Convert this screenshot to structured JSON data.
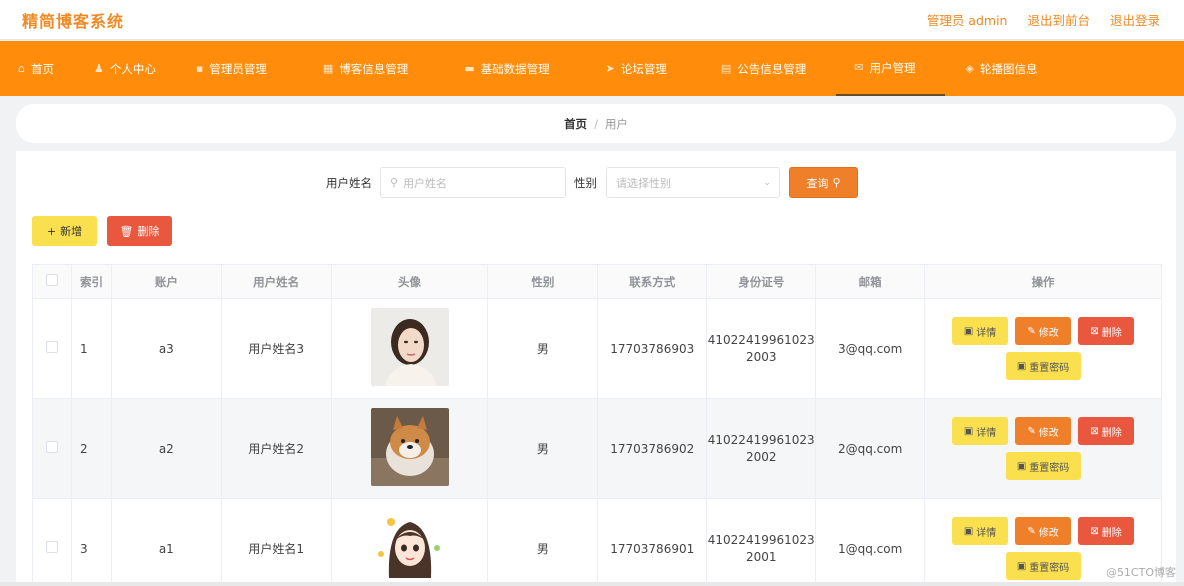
{
  "app": {
    "title": "精简博客系统"
  },
  "topbar": {
    "admin_label": "管理员 admin",
    "front_label": "退出到前台",
    "logout_label": "退出登录"
  },
  "nav": {
    "items": [
      {
        "label": "首页",
        "icon": "home-icon",
        "glyph": "⌂"
      },
      {
        "label": "个人中心",
        "icon": "user-icon",
        "glyph": "♟"
      },
      {
        "label": "管理员管理",
        "icon": "chat-icon",
        "glyph": "▪"
      },
      {
        "label": "博客信息管理",
        "icon": "grid-icon",
        "glyph": "▦"
      },
      {
        "label": "基础数据管理",
        "icon": "briefcase-icon",
        "glyph": "▬"
      },
      {
        "label": "论坛管理",
        "icon": "send-icon",
        "glyph": "➤"
      },
      {
        "label": "公告信息管理",
        "icon": "document-icon",
        "glyph": "▤"
      },
      {
        "label": "用户管理",
        "icon": "mail-icon",
        "glyph": "✉"
      },
      {
        "label": "轮播图信息",
        "icon": "image-icon",
        "glyph": "◈"
      }
    ],
    "active_index": 7
  },
  "breadcrumb": {
    "home": "首页",
    "separator": "/",
    "current": "用户"
  },
  "search": {
    "name_label": "用户姓名",
    "name_placeholder": "用户姓名",
    "gender_label": "性别",
    "gender_placeholder": "请选择性别",
    "query_button": "查询"
  },
  "actions": {
    "add_button": "新增",
    "delete_button": "删除"
  },
  "table": {
    "headers": [
      "索引",
      "账户",
      "用户姓名",
      "头像",
      "性别",
      "联系方式",
      "身份证号",
      "邮箱",
      "操作"
    ],
    "rows": [
      {
        "index": "1",
        "account": "a3",
        "name": "用户姓名3",
        "avatar": "woman-portrait",
        "gender": "男",
        "phone": "17703786903",
        "id_line1": "41022419961023",
        "id_line2": "2003",
        "email": "3@qq.com"
      },
      {
        "index": "2",
        "account": "a2",
        "name": "用户姓名2",
        "avatar": "shiba-dog",
        "gender": "男",
        "phone": "17703786902",
        "id_line1": "41022419961023",
        "id_line2": "2002",
        "email": "2@qq.com"
      },
      {
        "index": "3",
        "account": "a1",
        "name": "用户姓名1",
        "avatar": "cartoon-girl",
        "gender": "男",
        "phone": "17703786901",
        "id_line1": "41022419961023",
        "id_line2": "2001",
        "email": "1@qq.com"
      }
    ],
    "row_actions": {
      "detail": "详情",
      "edit": "修改",
      "delete": "删除",
      "reset_password": "重置密码"
    }
  },
  "watermark": "@51CTO博客",
  "colors": {
    "brand_orange": "#ff8c0a",
    "title_orange": "#f08a24",
    "yellow_button": "#fadf4f",
    "red_button": "#e9573f"
  }
}
